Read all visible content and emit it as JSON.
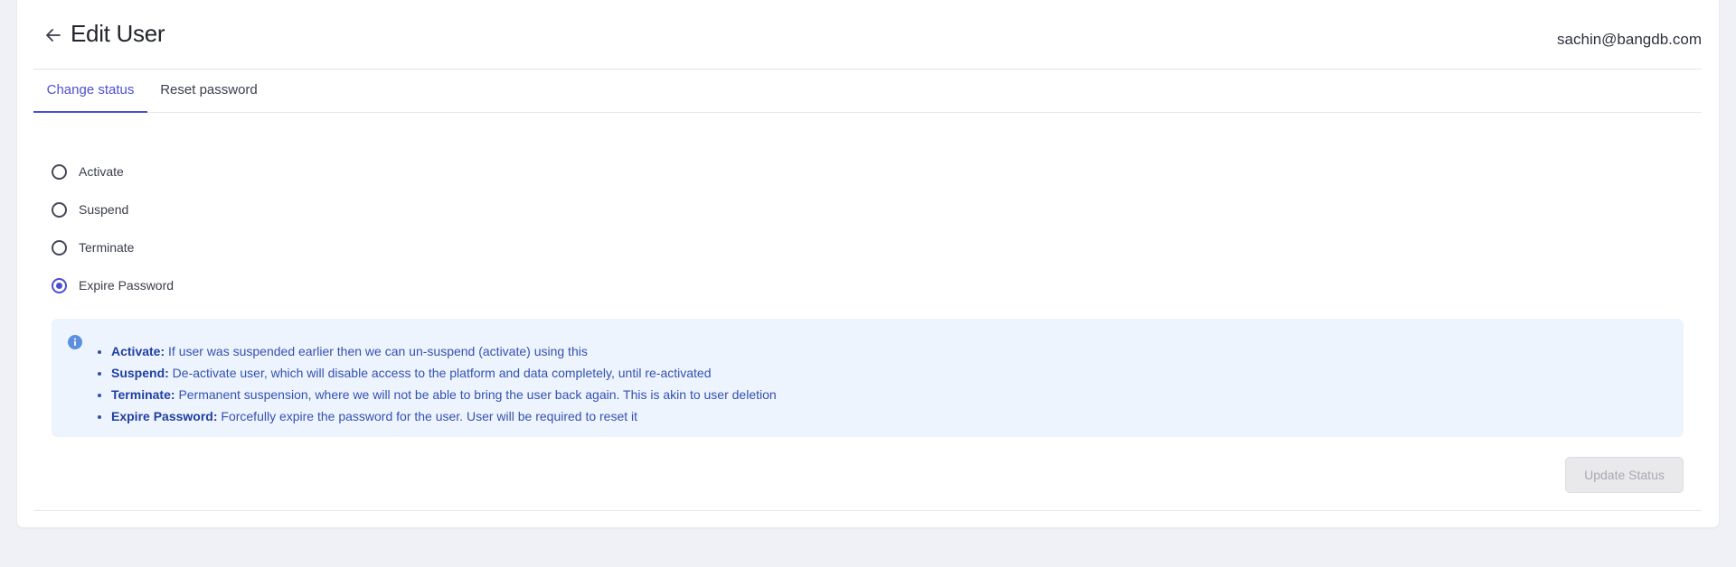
{
  "header": {
    "title": "Edit User",
    "user_email": "sachin@bangdb.com"
  },
  "tabs": [
    {
      "label": "Change status",
      "active": true
    },
    {
      "label": "Reset password",
      "active": false
    }
  ],
  "status_options": [
    {
      "label": "Activate",
      "selected": false
    },
    {
      "label": "Suspend",
      "selected": false
    },
    {
      "label": "Terminate",
      "selected": false
    },
    {
      "label": "Expire Password",
      "selected": true
    }
  ],
  "info": {
    "items": [
      {
        "term": "Activate:",
        "text": "If user was suspended earlier then we can un-suspend (activate) using this"
      },
      {
        "term": "Suspend:",
        "text": "De-activate user, which will disable access to the platform and data completely, until re-activated"
      },
      {
        "term": "Terminate:",
        "text": "Permanent suspension, where we will not be able to bring the user back again. This is akin to user deletion"
      },
      {
        "term": "Expire Password:",
        "text": "Forcefully expire the password for the user. User will be required to reset it"
      }
    ]
  },
  "actions": {
    "update_label": "Update Status",
    "update_disabled": true
  },
  "icons": {
    "back": "arrow-left-icon",
    "info": "info-circle-icon"
  },
  "colors": {
    "accent": "#4d4fd1",
    "info_bg": "#eef4fd",
    "info_text": "#2f4eb0",
    "page_bg": "#f0f1f6"
  }
}
